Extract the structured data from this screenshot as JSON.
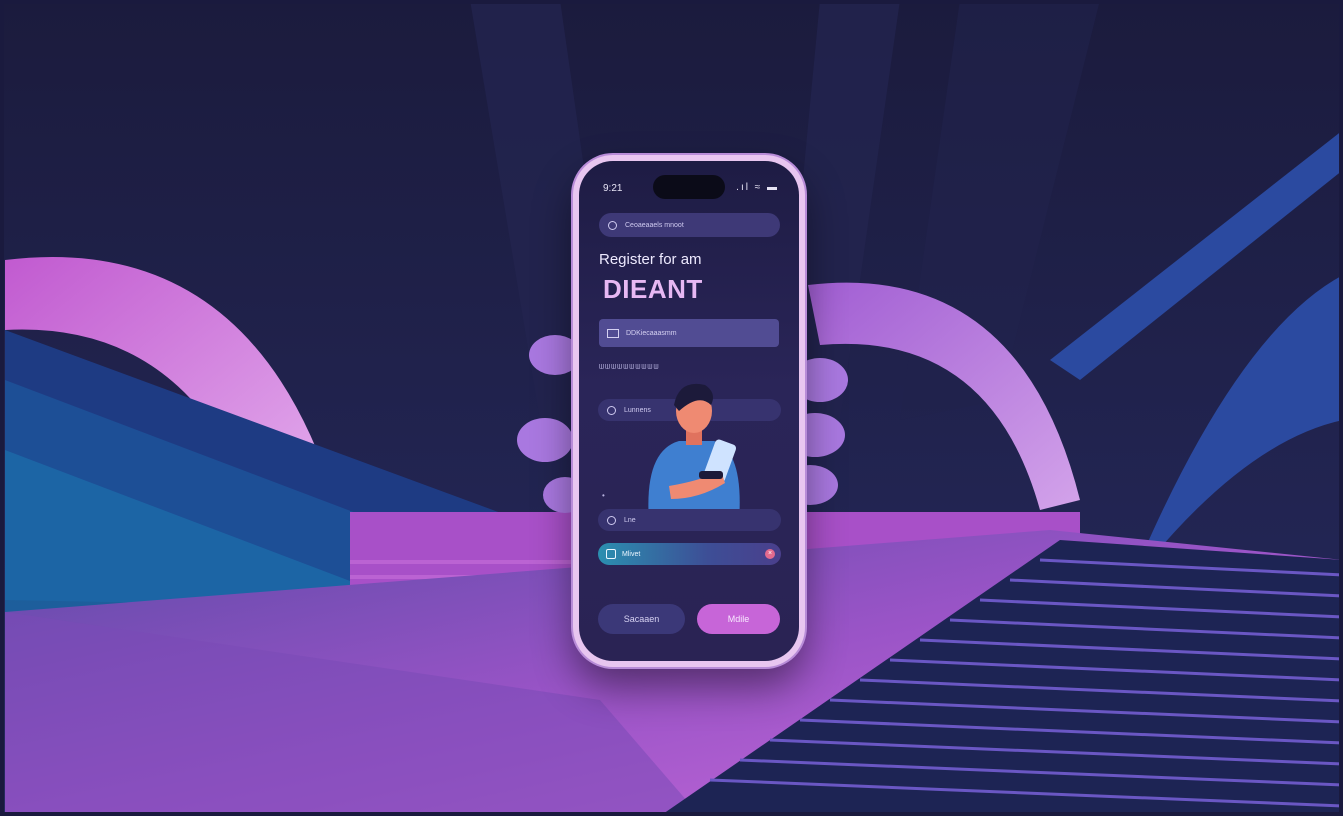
{
  "status_bar": {
    "time": "9:21",
    "icons": ".ıl ≈ ▬"
  },
  "search": {
    "text": "Ceoaeaaels mnoot"
  },
  "heading": {
    "line1": "Register for am",
    "line2": "DIEANT"
  },
  "field_primary": {
    "text": "DDKiecaaasmm"
  },
  "section": {
    "label": "ᗯᗯᗯᗯᗯᗯᗯᗯᗯᗯ"
  },
  "field_name": {
    "text": "Lunnens"
  },
  "marker": {
    "text": "•"
  },
  "field_small": {
    "text": "Lne"
  },
  "field_selected": {
    "text": "Mlivet",
    "clear_icon": "×"
  },
  "buttons": {
    "secondary_label": "Sacaaen",
    "primary_label": "Mdile"
  },
  "colors": {
    "background": "#1a1a3e",
    "accent_purple": "#c765d8",
    "phone_frame": "#e8c6f0",
    "screen": "#231f4c",
    "teal": "#2b8fb0"
  }
}
